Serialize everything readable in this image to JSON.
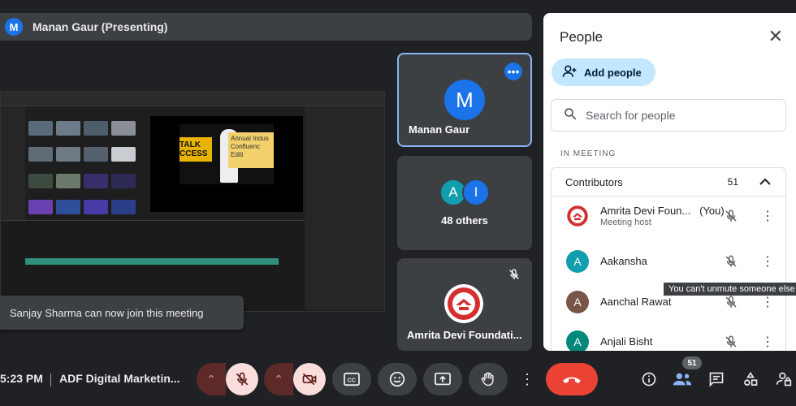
{
  "presenter": {
    "initial": "M",
    "label": "Manan Gaur (Presenting)"
  },
  "shared_screen": {
    "preview_banner": "TALK\nCCESS",
    "preview_side_text": "Annual Indus\nConfluenc\nEditi"
  },
  "toast": {
    "text": "Sanjay Sharma can now join this meeting"
  },
  "tiles": {
    "manan": {
      "initial": "M",
      "name": "Manan Gaur"
    },
    "others": {
      "avatars": [
        "A",
        "I"
      ],
      "label": "48 others"
    },
    "org": {
      "name": "Amrita Devi Foundati..."
    }
  },
  "people_panel": {
    "title": "People",
    "add_people_label": "Add people",
    "search_placeholder": "Search for people",
    "section_heading": "IN MEETING",
    "contributors_label": "Contributors",
    "contributors_count": "51",
    "participants": [
      {
        "initial": "",
        "name": "Amrita Devi Foun...",
        "tag": "(You)",
        "subtitle": "Meeting host",
        "avatar_color": "#ffffff"
      },
      {
        "initial": "A",
        "name": "Aakansha",
        "subtitle": "",
        "avatar_color": "#129eaf"
      },
      {
        "initial": "A",
        "name": "Aanchal Rawat",
        "subtitle": "",
        "avatar_color": "#795548"
      },
      {
        "initial": "A",
        "name": "Anjali Bisht",
        "subtitle": "",
        "avatar_color": "#00897b"
      }
    ],
    "tooltip": "You can't unmute someone else"
  },
  "bottom_bar": {
    "time": "5:23 PM",
    "meeting_title": "ADF Digital Marketin...",
    "participant_badge": "51"
  },
  "colors": {
    "accent": "#8ab4f8",
    "mic_off_bg": "#f9dedc",
    "end_call": "#ea4335",
    "panel_bg": "#ffffff"
  }
}
